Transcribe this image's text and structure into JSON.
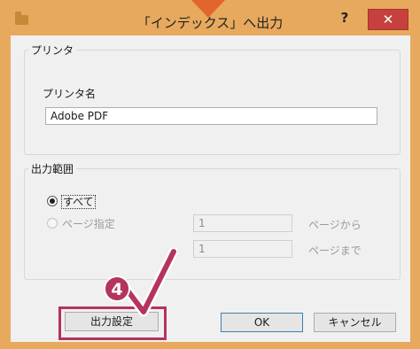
{
  "window": {
    "title": "「インデックス」へ出力",
    "help_label": "?",
    "close_label": "✕"
  },
  "printer_group": {
    "legend": "プリンタ",
    "name_label": "プリンタ名",
    "name_value": "Adobe PDF"
  },
  "range_group": {
    "legend": "出力範囲",
    "all_label": "すべて",
    "page_label": "ページ指定",
    "from_value": "1",
    "from_suffix": "ページから",
    "to_value": "1",
    "to_suffix": "ページまで"
  },
  "buttons": {
    "output_settings": "出力設定",
    "ok": "OK",
    "cancel": "キャンセル"
  },
  "annotation": {
    "step_number": "4",
    "color": "#b5345c",
    "arrow_color": "#e2662b"
  }
}
